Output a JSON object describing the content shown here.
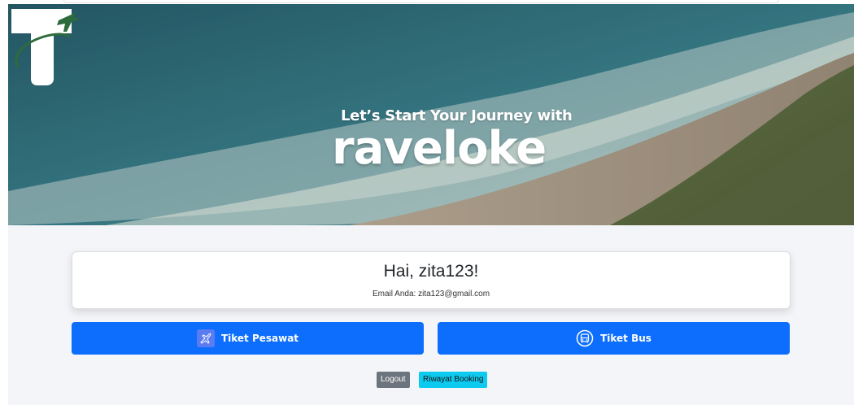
{
  "hero": {
    "tagline": "Let’s Start Your Journey with",
    "brand": "Traveloke",
    "brand_rest": "raveloke"
  },
  "greeting": {
    "title": "Hai, zita123!",
    "email_line": "Email Anda: zita123@gmail.com"
  },
  "actions": {
    "plane_label": "Tiket Pesawat",
    "bus_label": "Tiket Bus",
    "logout_label": "Logout",
    "history_label": "Riwayat Booking"
  },
  "colors": {
    "primary": "#0d6efd",
    "secondary": "#6c757d",
    "info": "#0dcaf0",
    "page_bg": "#f4f5f8",
    "logo_green": "#2e6b3c"
  },
  "icons": {
    "plane": "airplane-icon",
    "bus": "bus-icon"
  }
}
